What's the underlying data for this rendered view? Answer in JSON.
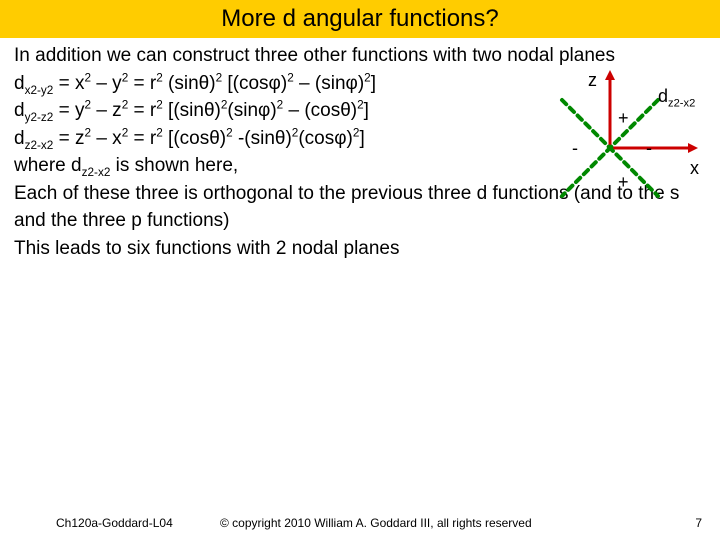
{
  "title": "More d angular functions?",
  "intro": "In addition we can construct three other functions with two nodal planes",
  "eq1_lhs": "d",
  "eq1_sub": "x2-y2",
  "eq1_rhs_a": " = x",
  "eq1_rhs_b": " – y",
  "eq1_rhs_c": " = r",
  "eq1_rhs_d": " (sinθ)",
  "eq1_rhs_e": " [(cosφ)",
  "eq1_rhs_f": " – (sinφ)",
  "eq1_rhs_g": "]",
  "eq2_lhs": "d",
  "eq2_sub": "y2-z2",
  "eq2_rhs_a": " = y",
  "eq2_rhs_b": " – z",
  "eq2_rhs_c": " = r",
  "eq2_rhs_d": " [(sinθ)",
  "eq2_rhs_e": "(sinφ)",
  "eq2_rhs_f": " – (cosθ)",
  "eq2_rhs_g": "]",
  "eq3_lhs": "d",
  "eq3_sub": "z2-x2",
  "eq3_rhs_a": " = z",
  "eq3_rhs_b": " – x",
  "eq3_rhs_c": " = r",
  "eq3_rhs_d": " [(cosθ)",
  "eq3_rhs_e": " -(sinθ)",
  "eq3_rhs_f": "(cosφ)",
  "eq3_rhs_g": "]",
  "where_a": "where d",
  "where_sub": "z2-x2",
  "where_b": " is shown here,",
  "orth": "Each of these three is orthogonal to the previous three d functions (and to the s and the three p functions)",
  "leads": "This leads to six functions with 2 nodal planes",
  "diagram": {
    "z_label": "z",
    "x_label": "x",
    "orb_label_pre": "d",
    "orb_label_sub": "z2-x2",
    "plus": "+",
    "minus": "-"
  },
  "footer": {
    "left": "Ch120a-Goddard-L04",
    "center": "© copyright 2010 William A. Goddard III, all rights reserved",
    "pagenum": "7"
  },
  "sup2": "2"
}
